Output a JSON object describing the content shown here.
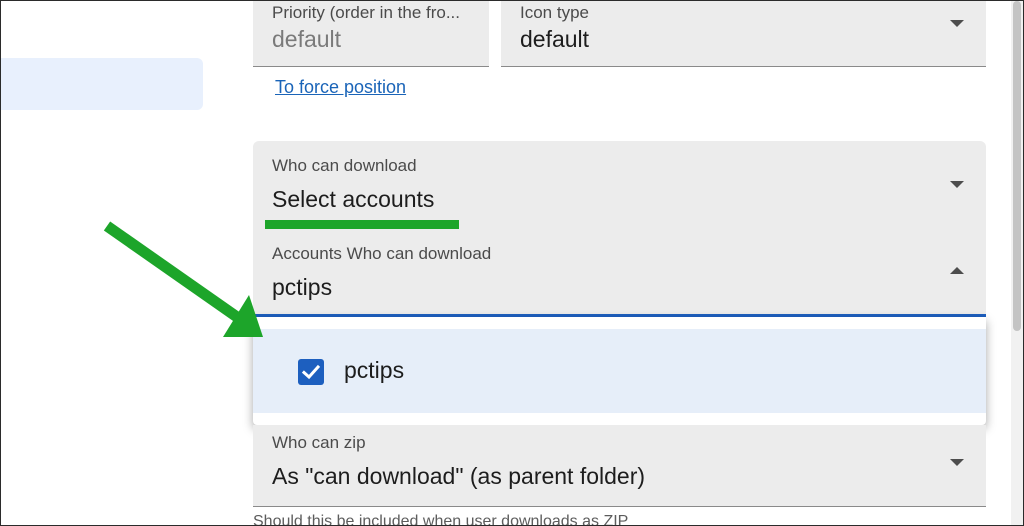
{
  "form": {
    "priority": {
      "label": "Priority (order in the fro...",
      "value": "default"
    },
    "icon_type": {
      "label": "Icon type",
      "value": "default"
    },
    "force_position_link": "To force position",
    "who_can_download": {
      "label": "Who can download",
      "value": "Select accounts"
    },
    "accounts_who_can_download": {
      "label": "Accounts Who can download",
      "value": "pctips",
      "options": [
        {
          "label": "pctips",
          "checked": true
        }
      ]
    },
    "who_can_zip": {
      "label": "Who can zip",
      "value": "As \"can download\" (as parent folder)"
    },
    "zip_helper": "Should this be included when user downloads as ZIP"
  },
  "colors": {
    "accent": "#1d5fbf",
    "annotation_green": "#1da52a",
    "field_bg": "#ececec",
    "selected_option_bg": "#e6eef9"
  },
  "icons": [
    "chevron-down-icon",
    "chevron-up-icon",
    "check-icon",
    "annotation-arrow-icon"
  ]
}
